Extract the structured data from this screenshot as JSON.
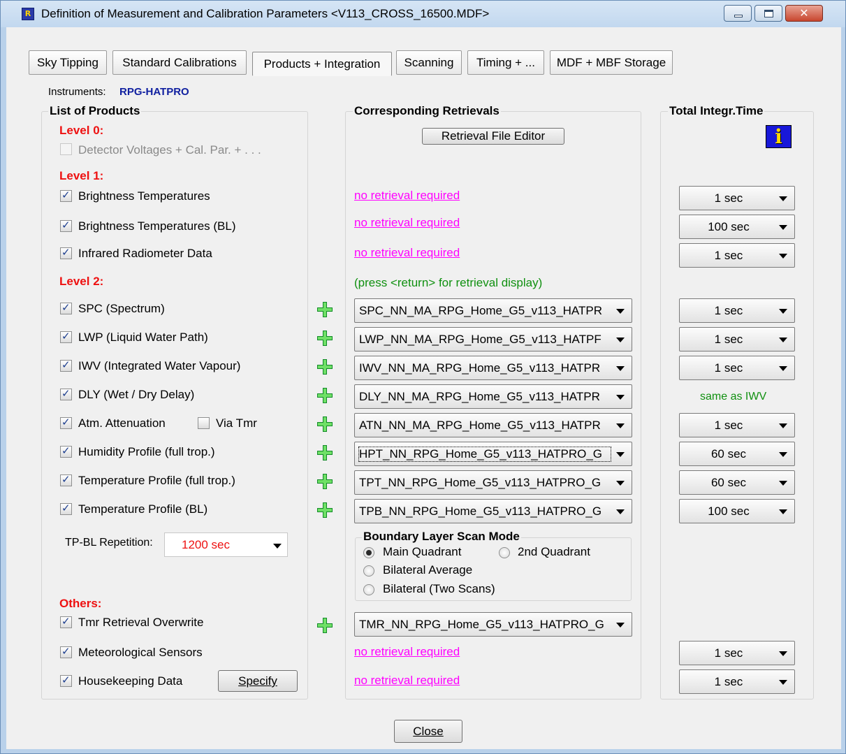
{
  "window": {
    "title": "Definition of Measurement and Calibration Parameters  <V113_CROSS_16500.MDF>",
    "controls": {
      "minimize_icon": "minimize-icon",
      "maximize_icon": "maximize-icon",
      "close_icon": "close-icon",
      "close_glyph": "✕"
    },
    "app_icon_glyph": "R"
  },
  "tabs": [
    "Sky Tipping",
    "Standard Calibrations",
    "Products + Integration",
    "Scanning",
    "Timing + ...",
    "MDF + MBF Storage"
  ],
  "active_tab": "Products + Integration",
  "instruments": {
    "label": "Instruments:",
    "value": "RPG-HATPRO"
  },
  "products": {
    "title": "List of Products",
    "level0": "Level 0:",
    "level1": "Level 1:",
    "level2": "Level 2:",
    "others": "Others:",
    "items": {
      "detector": "Detector Voltages + Cal. Par. + . . .",
      "bt": "Brightness Temperatures",
      "bt_bl": "Brightness Temperatures (BL)",
      "ir": "Infrared Radiometer Data",
      "spc": "SPC (Spectrum)",
      "lwp": "LWP (Liquid Water Path)",
      "iwv": "IWV (Integrated Water Vapour)",
      "dly": "DLY (Wet / Dry Delay)",
      "atn": "Atm. Attenuation",
      "via_tmr": "Via Tmr",
      "hpt": "Humidity Profile (full trop.)",
      "tpt": "Temperature Profile (full trop.)",
      "tpb": "Temperature Profile (BL)",
      "tmr": "Tmr Retrieval Overwrite",
      "met": "Meteorological Sensors",
      "hkd": "Housekeeping Data"
    },
    "tp_bl_repetition_label": "TP-BL Repetition:",
    "tp_bl_repetition_value": "1200 sec",
    "specify_button": "Specify"
  },
  "retrievals": {
    "title": "Corresponding Retrievals",
    "editor_button": "Retrieval File Editor",
    "no_retrieval": "no retrieval required",
    "hint": "(press <return> for retrieval display)",
    "spc": "SPC_NN_MA_RPG_Home_G5_v113_HATPR",
    "lwp": "LWP_NN_MA_RPG_Home_G5_v113_HATPF",
    "iwv": "IWV_NN_MA_RPG_Home_G5_v113_HATPR",
    "dly": "DLY_NN_MA_RPG_Home_G5_v113_HATPR",
    "atn": "ATN_NN_MA_RPG_Home_G5_v113_HATPR",
    "hpt": "HPT_NN_RPG_Home_G5_v113_HATPRO_G",
    "tpt": "TPT_NN_RPG_Home_G5_v113_HATPRO_G",
    "tpb": "TPB_NN_RPG_Home_G5_v113_HATPRO_G",
    "tmr": "TMR_NN_RPG_Home_G5_v113_HATPRO_G",
    "bl_scan": {
      "title": "Boundary Layer Scan Mode",
      "main_quadrant": "Main Quadrant",
      "second_quadrant": "2nd Quadrant",
      "bilateral_average": "Bilateral Average",
      "bilateral_two": "Bilateral (Two Scans)",
      "selected": "Main Quadrant"
    }
  },
  "integration": {
    "title": "Total Integr.Time",
    "info_icon": "info-icon",
    "bt": "1 sec",
    "bt_bl": "100 sec",
    "ir": "1 sec",
    "spc": "1 sec",
    "lwp": "1 sec",
    "iwv": "1 sec",
    "dly_same": "same as IWV",
    "atn": "1 sec",
    "hpt": "60 sec",
    "tpt": "60 sec",
    "tpb": "100 sec",
    "met": "1 sec",
    "hkd": "1 sec"
  },
  "close_button": "Close",
  "colors": {
    "level": "#ee1111",
    "link": "#ff00ff",
    "hint": "#109010",
    "instrument": "#1020a0",
    "plus": "#128a28"
  }
}
